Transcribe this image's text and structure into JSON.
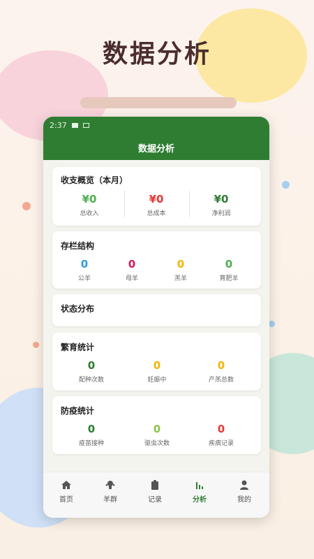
{
  "hero": {
    "title": "数据分析"
  },
  "status_bar": {
    "time": "2:37"
  },
  "app": {
    "title": "数据分析"
  },
  "colors": {
    "primary": "#2f7d32",
    "green": "#4caf50",
    "red": "#e53935",
    "yellow": "#f5b400",
    "blue": "#2e9be6",
    "pink": "#d81b60",
    "olive": "#8bc34a"
  },
  "income": {
    "title": "收支概览（本月）",
    "stats": [
      {
        "value": "¥0",
        "label": "总收入"
      },
      {
        "value": "¥0",
        "label": "总成本"
      },
      {
        "value": "¥0",
        "label": "净利润"
      }
    ]
  },
  "stock": {
    "title": "存栏结构",
    "stats": [
      {
        "value": "0",
        "label": "公羊"
      },
      {
        "value": "0",
        "label": "母羊"
      },
      {
        "value": "0",
        "label": "羔羊"
      },
      {
        "value": "0",
        "label": "育肥羊"
      }
    ]
  },
  "status": {
    "title": "状态分布"
  },
  "breeding": {
    "title": "繁育统计",
    "stats": [
      {
        "value": "0",
        "label": "配种次数"
      },
      {
        "value": "0",
        "label": "妊娠中"
      },
      {
        "value": "0",
        "label": "产羔总数"
      }
    ]
  },
  "epidemic": {
    "title": "防疫统计",
    "stats": [
      {
        "value": "0",
        "label": "疫苗接种"
      },
      {
        "value": "0",
        "label": "驱虫次数"
      },
      {
        "value": "0",
        "label": "疾病记录"
      }
    ]
  },
  "tabs": [
    {
      "label": "首页",
      "icon": "home-icon"
    },
    {
      "label": "羊群",
      "icon": "sheep-icon"
    },
    {
      "label": "记录",
      "icon": "clipboard-icon"
    },
    {
      "label": "分析",
      "icon": "chart-icon",
      "active": true
    },
    {
      "label": "我的",
      "icon": "person-icon"
    }
  ]
}
